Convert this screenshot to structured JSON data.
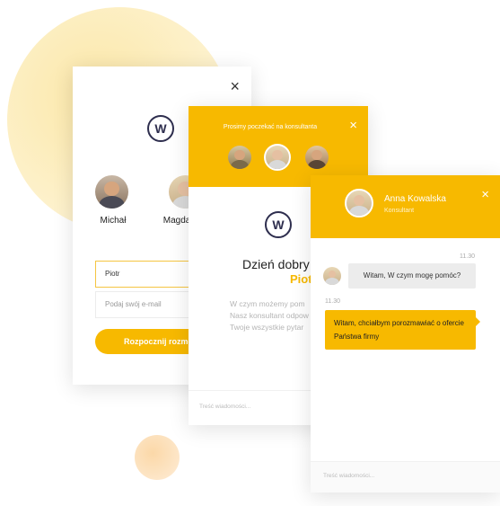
{
  "login": {
    "close_icon": "×",
    "logo_letter": "W",
    "consultants": [
      {
        "name": "Michał"
      },
      {
        "name": "Magdalena"
      }
    ],
    "name_value": "Piotr",
    "email_placeholder": "Podaj swój e-mail",
    "start_button": "Rozpocznij rozmo"
  },
  "waiting": {
    "header_text": "Prosimy poczekać na konsultanta",
    "close_icon": "×",
    "logo_letter": "W",
    "greeting": "Dzień dobry",
    "greeting_name": "Piotr!",
    "lines": [
      "W czym możemy pom",
      "Nasz konsultant odpow",
      "Twoje wszystkie pytar"
    ],
    "message_placeholder": "Treść wiadomości..."
  },
  "chat": {
    "agent_name": "Anna Kowalska",
    "agent_role": "Konsultant",
    "close_icon": "×",
    "messages": [
      {
        "time": "11.30",
        "text": "Witam, W czym mogę pomóc?"
      },
      {
        "time": "11.30",
        "text": "Witam, chciałbym porozmawiać o ofercie Państwa firmy"
      }
    ],
    "message_placeholder": "Treść wiadomości..."
  },
  "colors": {
    "accent": "#f7b900",
    "logo": "#2e2e4e"
  }
}
